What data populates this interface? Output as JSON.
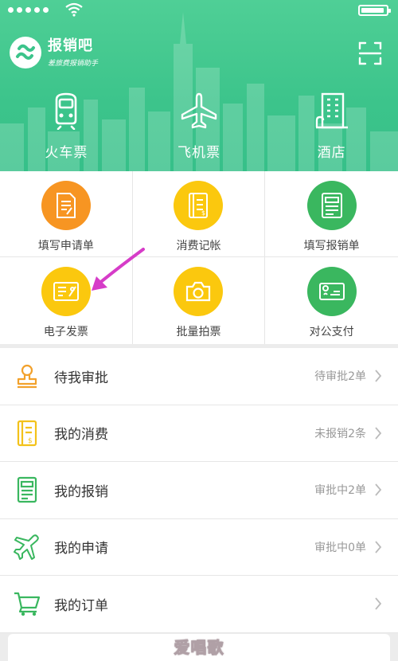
{
  "header": {
    "brand_name": "报销吧",
    "brand_slogan": "差旅费报销助手",
    "top_nav": [
      {
        "label": "火车票",
        "icon": "train-icon"
      },
      {
        "label": "飞机票",
        "icon": "plane-icon"
      },
      {
        "label": "酒店",
        "icon": "hotel-icon"
      }
    ]
  },
  "grid": [
    {
      "label": "填写申请单",
      "icon": "application-form-icon",
      "color": "#f79522"
    },
    {
      "label": "消费记帐",
      "icon": "expense-ledger-icon",
      "color": "#fbc80e"
    },
    {
      "label": "填写报销单",
      "icon": "reimbursement-form-icon",
      "color": "#3ab75f"
    },
    {
      "label": "电子发票",
      "icon": "e-invoice-icon",
      "color": "#fbc80e"
    },
    {
      "label": "批量拍票",
      "icon": "camera-icon",
      "color": "#fbc80e"
    },
    {
      "label": "对公支付",
      "icon": "corporate-payment-icon",
      "color": "#3ab75f"
    }
  ],
  "annotation_arrow_color": "#d63cc8",
  "list": [
    {
      "title": "待我审批",
      "status": "待审批2单",
      "icon": "stamp-icon"
    },
    {
      "title": "我的消费",
      "status": "未报销2条",
      "icon": "receipt-icon"
    },
    {
      "title": "我的报销",
      "status": "审批中2单",
      "icon": "reimbursement-icon"
    },
    {
      "title": "我的申请",
      "status": "审批中0单",
      "icon": "flight-request-icon"
    },
    {
      "title": "我的订单",
      "status": "",
      "icon": "cart-icon"
    }
  ],
  "watermark": "爱唱歌"
}
